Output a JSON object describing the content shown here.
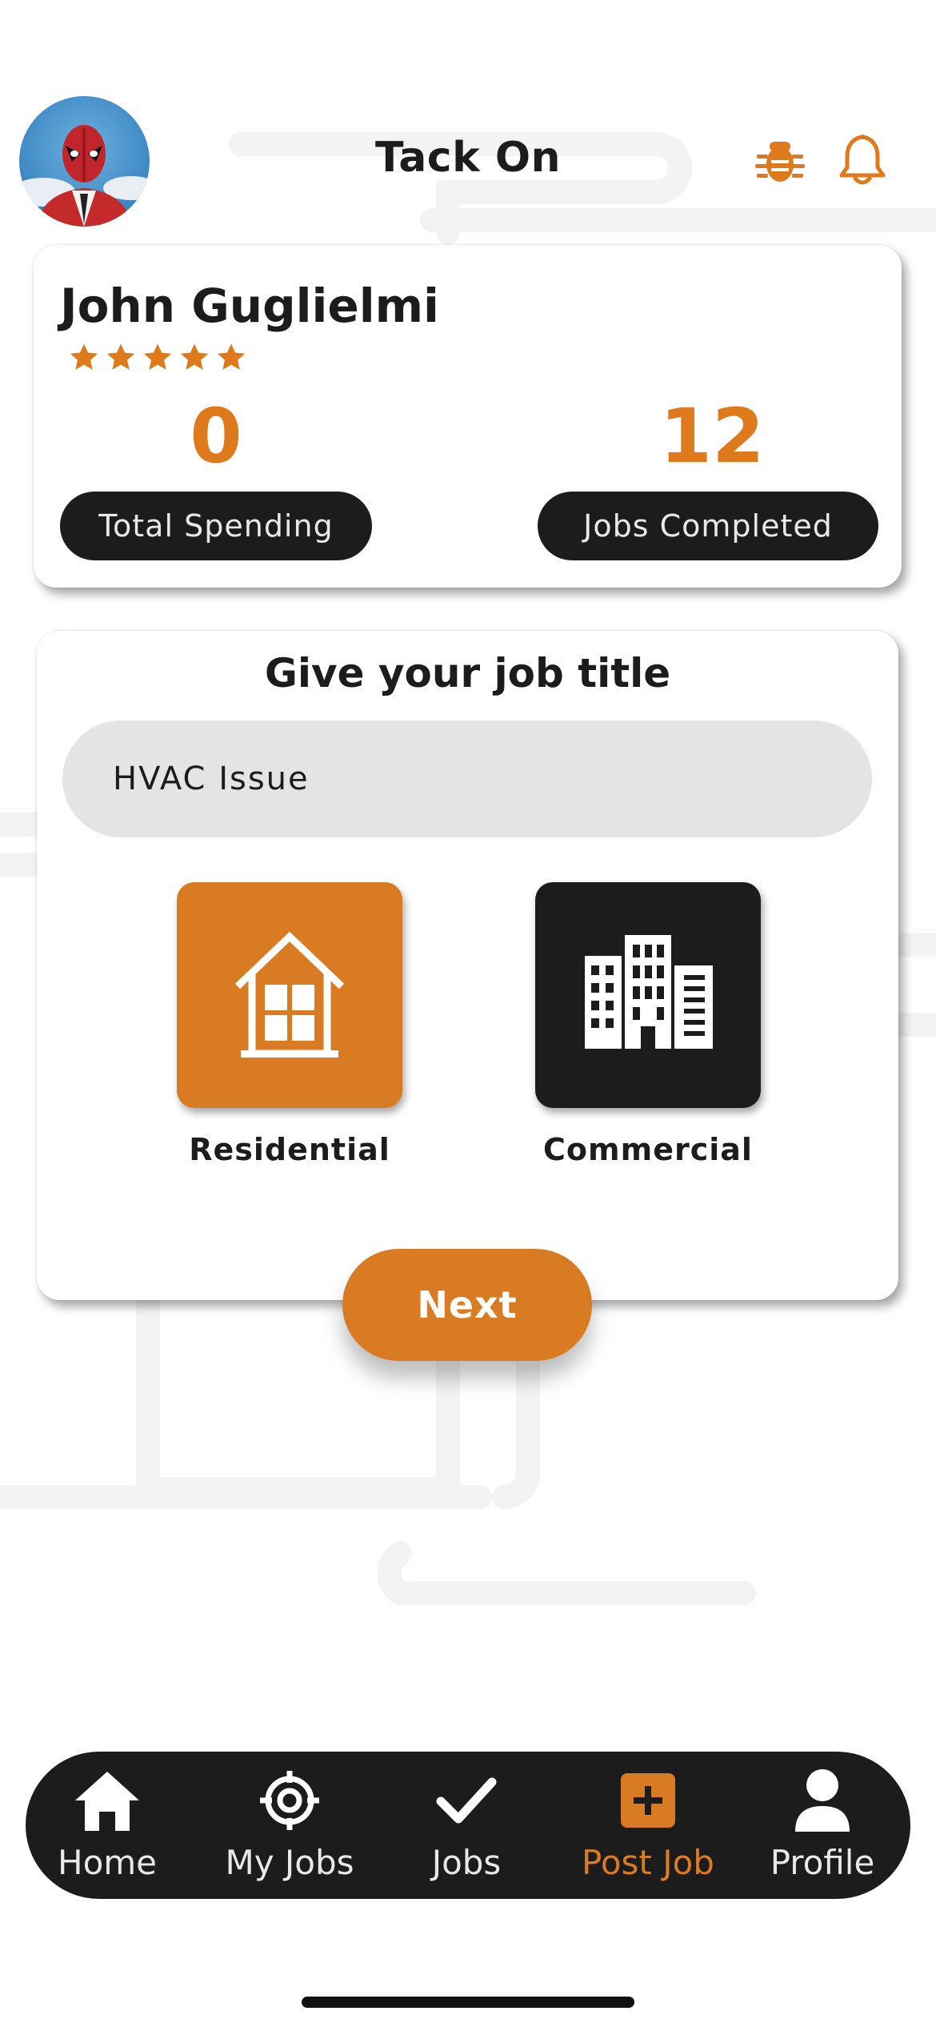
{
  "app": {
    "title": "Tack On"
  },
  "profile": {
    "name": "John Guglielmi",
    "rating": 5,
    "total_spending_value": "0",
    "total_spending_label": "Total Spending",
    "jobs_completed_value": "12",
    "jobs_completed_label": "Jobs Completed"
  },
  "job_form": {
    "heading": "Give your job title",
    "title_value": "HVAC Issue",
    "options": [
      {
        "label": "Residential",
        "selected": true,
        "icon": "house-icon"
      },
      {
        "label": "Commercial",
        "selected": false,
        "icon": "office-buildings-icon"
      }
    ],
    "next_label": "Next"
  },
  "tabbar": {
    "items": [
      {
        "label": "Home",
        "icon": "home-icon",
        "active": false
      },
      {
        "label": "My Jobs",
        "icon": "crosshair-icon",
        "active": false
      },
      {
        "label": "Jobs",
        "icon": "checkmark-icon",
        "active": false
      },
      {
        "label": "Post Job",
        "icon": "plus-square-icon",
        "active": true
      },
      {
        "label": "Profile",
        "icon": "person-icon",
        "active": false
      }
    ]
  },
  "colors": {
    "accent": "#d97b22",
    "dark": "#1c1c1c",
    "input_bg": "#e4e4e4"
  }
}
